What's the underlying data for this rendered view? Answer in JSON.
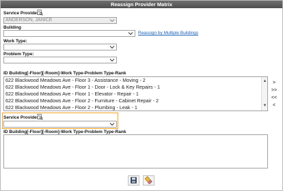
{
  "window": {
    "title": "Reassign Provider Matrix"
  },
  "service_provider": {
    "label": "Service Provider:",
    "value": "ANDERSON, JANICE"
  },
  "building": {
    "label": "Building",
    "value": "",
    "link": "Reassign by Multiple Buildings"
  },
  "work_type": {
    "label": "Work Type:",
    "value": ""
  },
  "problem_type": {
    "label": "Problem Type:",
    "value": ""
  },
  "source_list": {
    "label": "ID Building[-Floor][-Room]-Work Type-Problem Type-Rank",
    "items": [
      "622 Blackwood Meadows Ave - Floor 3 - Assistance - Moving - 2",
      "622 Blackwood Meadows Ave - Floor 1 - Door - Lock & Key Repairs - 1",
      "622 Blackwood Meadows Ave - Floor 1 - Elevator - Repair - 1",
      "622 Blackwood Meadows Ave - Floor 2 - Furniture - Cabinet Repair - 2",
      "622 Blackwood Meadows Ave - Floor 2 - Plumbing - Leak - 1"
    ]
  },
  "move_buttons": {
    "add": ">",
    "add_all": ">>",
    "remove_all": "<<",
    "remove": "<"
  },
  "target_provider": {
    "label": "Service Provider:",
    "value": ""
  },
  "target_list": {
    "label": "ID Building[-Floor][-Room]-Work Type-Problem Type-Rank",
    "items": []
  },
  "icons": {
    "lookup": "lookup-icon",
    "save": "save-icon",
    "clear": "eraser-icon"
  },
  "colors": {
    "title_bar": "#5a5a5a",
    "focus_border": "#f0a020",
    "link": "#1a5fb4"
  }
}
